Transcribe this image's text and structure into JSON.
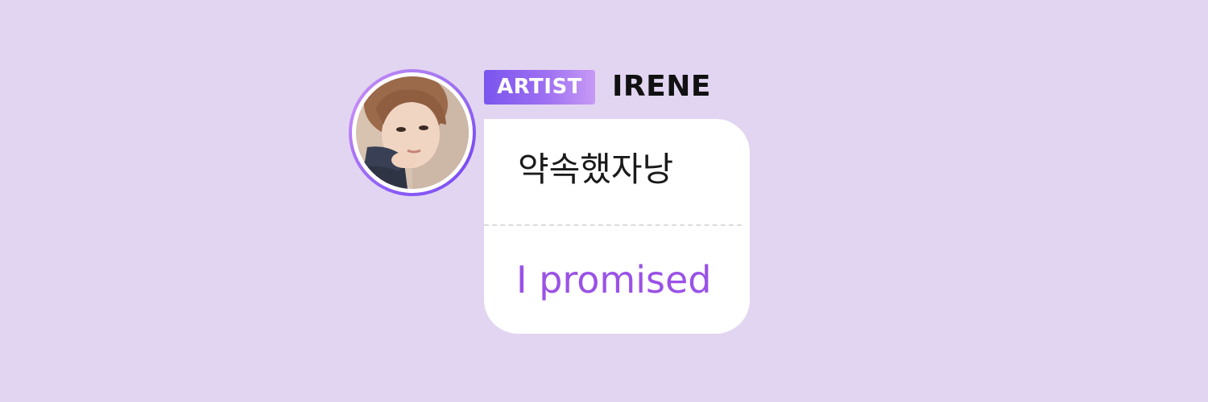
{
  "background_color": "#e2d5f1",
  "post": {
    "author": {
      "badge_label": "ARTIST",
      "name": "IRENE",
      "avatar_icon": "profile-photo"
    },
    "message": {
      "original_text": "약속했자낭",
      "translated_text": "I promised"
    }
  },
  "colors": {
    "badge_gradient_start": "#7a55ee",
    "badge_gradient_end": "#c79af6",
    "translation_text": "#9a52e6",
    "bubble_background": "#ffffff"
  }
}
